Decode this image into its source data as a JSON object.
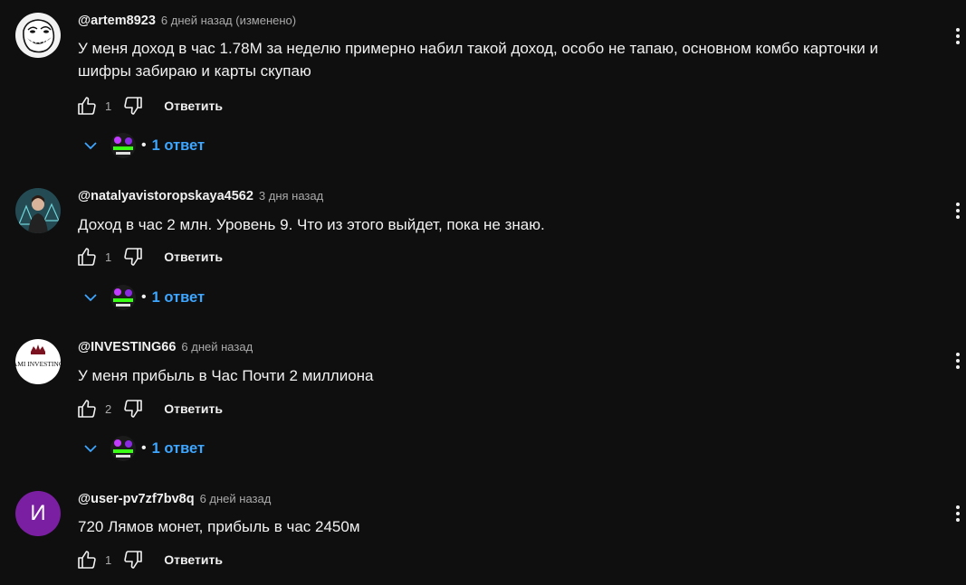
{
  "comments": [
    {
      "author": "@artem8923",
      "time": "6 дней назад (изменено)",
      "text": "У меня доход в час 1.78M за неделю примерно набил такой доход, особо не тапаю, основном комбо карточки и шифры забираю и карты скупаю",
      "likes": "1",
      "reply_label": "Ответить",
      "replies_label": "1 ответ",
      "avatar": "trollface-avatar"
    },
    {
      "author": "@natalyavistoropskaya4562",
      "time": "3 дня назад",
      "text": "Доход в час 2 млн. Уровень 9. Что из этого выйдет,  пока не знаю.",
      "likes": "1",
      "reply_label": "Ответить",
      "replies_label": "1 ответ",
      "avatar": "photo-avatar"
    },
    {
      "author": "@INVESTING66",
      "time": "6 дней назад",
      "text": "У меня прибыль в Час  Почти 2 миллиона",
      "likes": "2",
      "reply_label": "Ответить",
      "replies_label": "1 ответ",
      "avatar": "investing-logo-avatar",
      "avatar_text": "AMI INVESTING"
    },
    {
      "author": "@user-pv7zf7bv8q",
      "time": "6 дней назад",
      "text": "720 Лямов монет, прибыль в час 2450м",
      "likes": "1",
      "reply_label": "Ответить",
      "avatar": "letter-avatar",
      "avatar_letter": "И",
      "avatar_color": "#7b1fa2"
    }
  ],
  "colors": {
    "background": "#0f0f0f",
    "link": "#3ea6ff",
    "secondary_text": "#aaaaaa"
  }
}
